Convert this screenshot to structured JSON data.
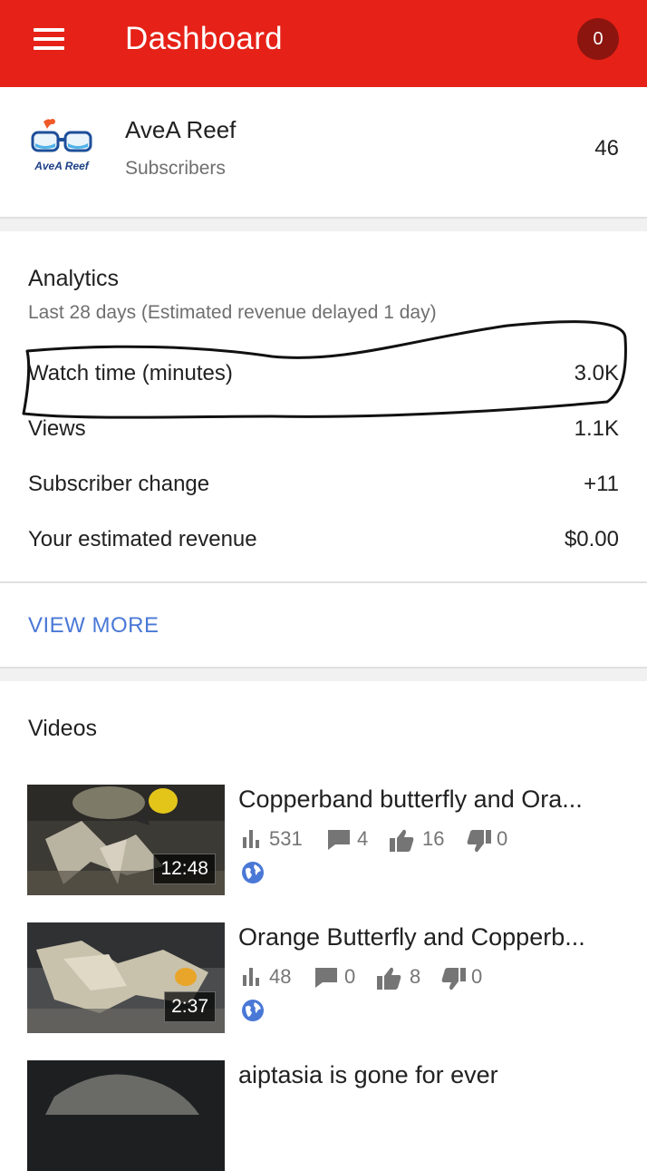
{
  "appbar": {
    "title": "Dashboard",
    "notification_count": "0",
    "bg_color": "#e62117",
    "menu_icon": "hamburger-menu-icon"
  },
  "channel": {
    "logo_text": "AveA Reef",
    "name": "AveA Reef",
    "subscribers_label": "Subscribers",
    "subscribers_count": "46"
  },
  "analytics": {
    "title": "Analytics",
    "note": "Last 28 days (Estimated revenue delayed 1 day)",
    "metrics": [
      {
        "label": "Watch time (minutes)",
        "value": "3.0K"
      },
      {
        "label": "Views",
        "value": "1.1K"
      },
      {
        "label": "Subscriber change",
        "value": "+11"
      },
      {
        "label": "Your estimated revenue",
        "value": "$0.00"
      }
    ],
    "view_more": "VIEW MORE",
    "link_color": "#4a78d6"
  },
  "videos": {
    "title": "Videos",
    "items": [
      {
        "title": "Copperband butterfly and Ora...",
        "duration": "12:48",
        "views": "531",
        "comments": "4",
        "likes": "16",
        "dislikes": "0",
        "visibility_icon": "public-globe-icon"
      },
      {
        "title": "Orange Butterfly and Copperb...",
        "duration": "2:37",
        "views": "48",
        "comments": "0",
        "likes": "8",
        "dislikes": "0",
        "visibility_icon": "public-globe-icon"
      },
      {
        "title": "aiptasia is gone for ever"
      }
    ]
  }
}
